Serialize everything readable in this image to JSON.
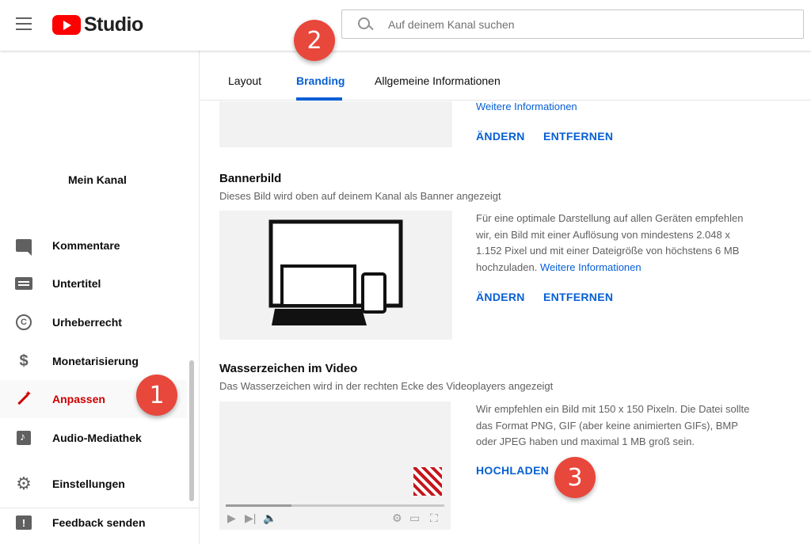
{
  "header": {
    "logo_text": "Studio",
    "search_placeholder": "Auf deinem Kanal suchen"
  },
  "sidebar": {
    "channel_name": "Mein Kanal",
    "items": [
      {
        "label": "Kommentare",
        "icon": "comment-icon"
      },
      {
        "label": "Untertitel",
        "icon": "subtitles-icon"
      },
      {
        "label": "Urheberrecht",
        "icon": "copyright-icon"
      },
      {
        "label": "Monetarisierung",
        "icon": "dollar-icon"
      },
      {
        "label": "Anpassen",
        "icon": "magic-wand-icon",
        "active": true
      },
      {
        "label": "Audio-Mediathek",
        "icon": "audio-library-icon"
      }
    ],
    "bottom_items": [
      {
        "label": "Einstellungen",
        "icon": "gear-icon"
      },
      {
        "label": "Feedback senden",
        "icon": "feedback-icon"
      }
    ]
  },
  "tabs": [
    {
      "label": "Layout"
    },
    {
      "label": "Branding",
      "active": true
    },
    {
      "label": "Allgemeine Informationen"
    }
  ],
  "profile_section": {
    "more_info": "Weitere Informationen",
    "change": "ÄNDERN",
    "remove": "ENTFERNEN"
  },
  "banner_section": {
    "title": "Bannerbild",
    "description": "Dieses Bild wird oben auf deinem Kanal als Banner angezeigt",
    "info": "Für eine optimale Darstellung auf allen Geräten empfehlen wir, ein Bild mit einer Auflösung von mindestens 2.048 x 1.152 Pixel und mit einer Dateigröße von höchstens 6 MB hochzuladen.",
    "more_info": "Weitere Informationen",
    "change": "ÄNDERN",
    "remove": "ENTFERNEN"
  },
  "watermark_section": {
    "title": "Wasserzeichen im Video",
    "description": "Das Wasserzeichen wird in der rechten Ecke des Videoplayers angezeigt",
    "info": "Wir empfehlen ein Bild mit 150 x 150 Pixeln. Die Datei sollte das Format PNG, GIF (aber keine animierten GIFs), BMP oder JPEG haben und maximal 1 MB groß sein.",
    "upload": "HOCHLADEN",
    "player_progress": 0.3
  },
  "markers": [
    "1",
    "2",
    "3"
  ],
  "colors": {
    "accent_blue": "#065fd4",
    "active_red": "#cc0000",
    "marker_red": "#e8473b",
    "logo_red": "#ff0000"
  }
}
